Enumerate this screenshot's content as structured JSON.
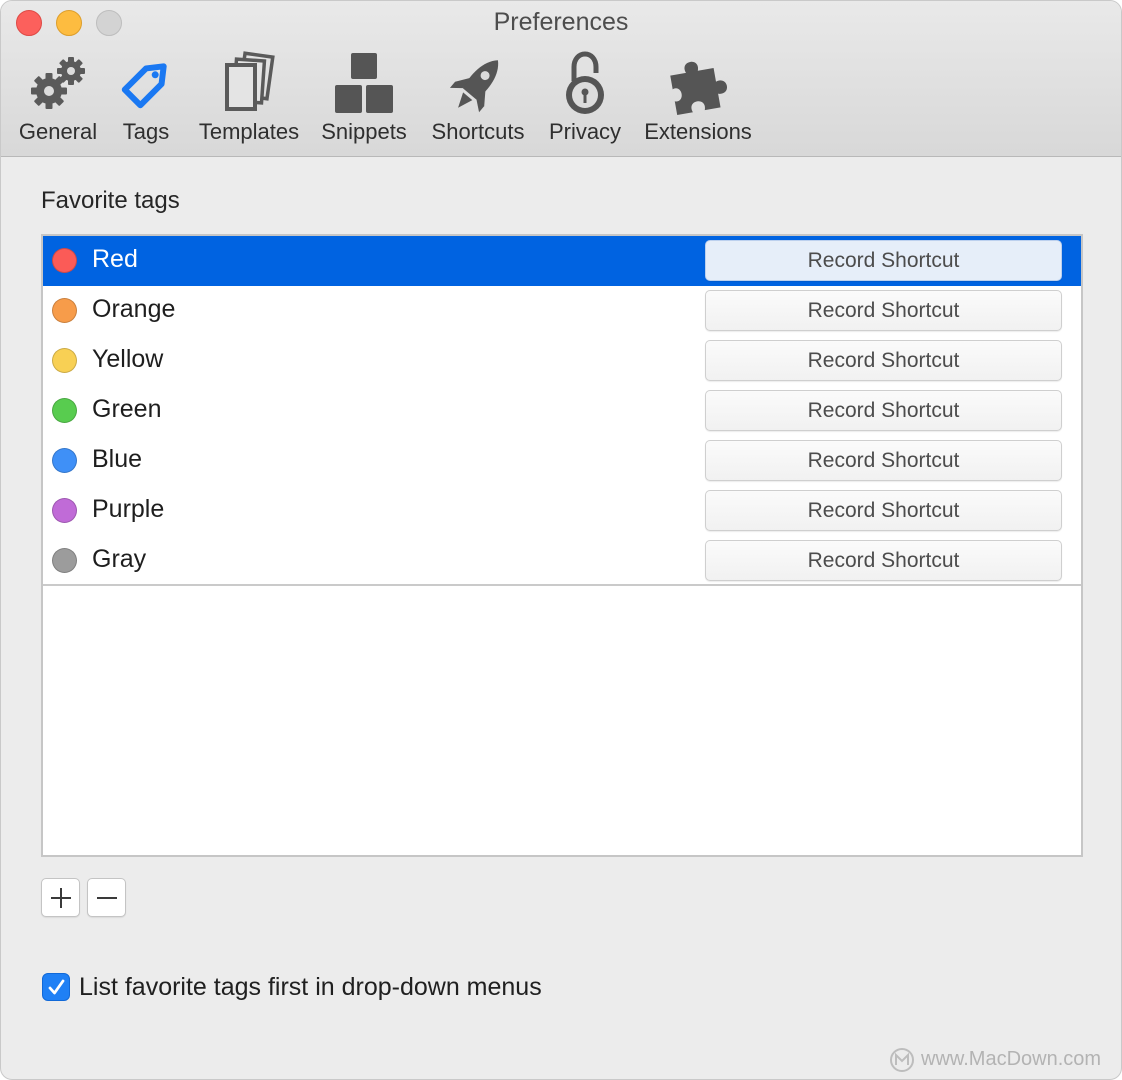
{
  "window": {
    "title": "Preferences"
  },
  "toolbar": {
    "tabs": [
      {
        "label": "General",
        "icon": "gears-icon"
      },
      {
        "label": "Tags",
        "icon": "tag-icon",
        "active": true
      },
      {
        "label": "Templates",
        "icon": "templates-icon"
      },
      {
        "label": "Snippets",
        "icon": "snippets-icon"
      },
      {
        "label": "Shortcuts",
        "icon": "rocket-icon"
      },
      {
        "label": "Privacy",
        "icon": "padlock-icon"
      },
      {
        "label": "Extensions",
        "icon": "puzzle-icon"
      }
    ]
  },
  "favorite_tags": {
    "title": "Favorite tags",
    "selected_index": 0,
    "items": [
      {
        "name": "Red",
        "color": "#fb5b57",
        "shortcut_label": "Record Shortcut"
      },
      {
        "name": "Orange",
        "color": "#f79c4a",
        "shortcut_label": "Record Shortcut"
      },
      {
        "name": "Yellow",
        "color": "#f8d054",
        "shortcut_label": "Record Shortcut"
      },
      {
        "name": "Green",
        "color": "#58cc4f",
        "shortcut_label": "Record Shortcut"
      },
      {
        "name": "Blue",
        "color": "#3f90f7",
        "shortcut_label": "Record Shortcut"
      },
      {
        "name": "Purple",
        "color": "#c06bd7",
        "shortcut_label": "Record Shortcut"
      },
      {
        "name": "Gray",
        "color": "#9c9c9c",
        "shortcut_label": "Record Shortcut"
      }
    ]
  },
  "list_controls": {
    "add_label": "+",
    "remove_label": "−"
  },
  "options": {
    "list_first": {
      "label": "List favorite tags first in drop-down menus",
      "checked": true
    }
  },
  "watermark": {
    "text": "www.MacDown.com"
  },
  "colors": {
    "selection": "#0063e1",
    "accent": "#1f80f5",
    "tags_icon": "#1a78f2"
  }
}
